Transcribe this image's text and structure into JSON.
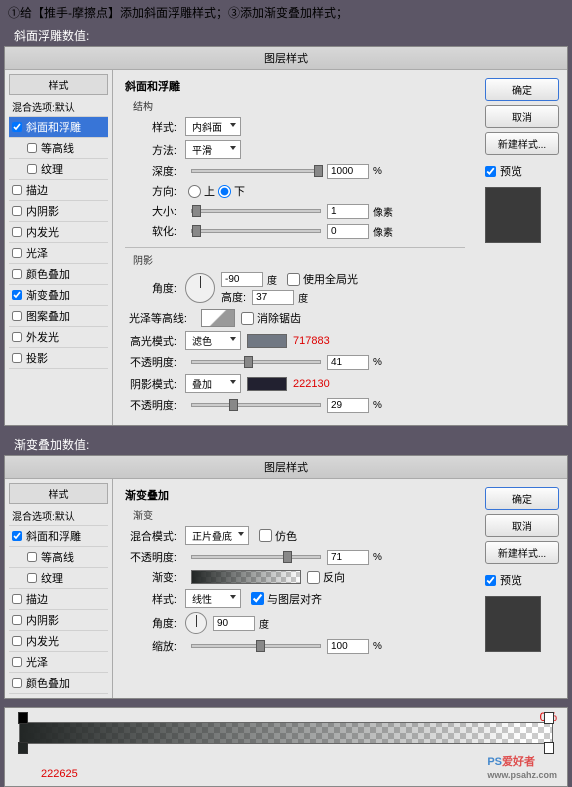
{
  "header": "①给【推手-摩擦点】添加斜面浮雕样式；③添加渐变叠加样式；",
  "labels": {
    "bevel": "斜面浮雕数值:",
    "gradient": "渐变叠加数值:"
  },
  "dialog_title": "图层样式",
  "style_list": {
    "header": "样式",
    "blend": "混合选项:默认",
    "bevel": "斜面和浮雕",
    "contour": "等高线",
    "texture": "纹理",
    "stroke": "描边",
    "inner_shadow": "内阴影",
    "inner_glow": "内发光",
    "satin": "光泽",
    "color_overlay": "颜色叠加",
    "grad_overlay": "渐变叠加",
    "pattern_overlay": "图案叠加",
    "outer_glow": "外发光",
    "drop_shadow": "投影"
  },
  "buttons": {
    "ok": "确定",
    "cancel": "取消",
    "new": "新建样式...",
    "preview": "预览"
  },
  "bevel_panel": {
    "title": "斜面和浮雕",
    "structure": "结构",
    "style_l": "样式:",
    "style_v": "内斜面",
    "method_l": "方法:",
    "method_v": "平滑",
    "depth_l": "深度:",
    "depth_v": "1000",
    "pct": "%",
    "dir_l": "方向:",
    "up": "上",
    "down": "下",
    "size_l": "大小:",
    "size_v": "1",
    "px": "像素",
    "soften_l": "软化:",
    "soften_v": "0",
    "shading": "阴影",
    "angle_l": "角度:",
    "angle_v": "-90",
    "deg": "度",
    "global": "使用全局光",
    "alt_l": "高度:",
    "alt_v": "37",
    "gloss_l": "光泽等高线:",
    "anti": "消除锯齿",
    "hl_mode_l": "高光模式:",
    "hl_mode_v": "滤色",
    "hl_hex": "717883",
    "hl_op_l": "不透明度:",
    "hl_op_v": "41",
    "sh_mode_l": "阴影模式:",
    "sh_mode_v": "叠加",
    "sh_hex": "222130",
    "sh_op_l": "不透明度:",
    "sh_op_v": "29"
  },
  "grad_panel": {
    "title": "渐变叠加",
    "sub": "渐变",
    "blend_l": "混合模式:",
    "blend_v": "正片叠底",
    "dither": "仿色",
    "op_l": "不透明度:",
    "op_v": "71",
    "pct": "%",
    "grad_l": "渐变:",
    "reverse": "反向",
    "style_l": "样式:",
    "style_v": "线性",
    "align": "与图层对齐",
    "angle_l": "角度:",
    "angle_v": "90",
    "deg": "度",
    "scale_l": "缩放:",
    "scale_v": "100"
  },
  "bottom": {
    "pct0": "0%",
    "hex": "222625"
  },
  "wm": {
    "brand": "PS",
    "suffix": "爱好者",
    "url": "www.psahz.com"
  }
}
